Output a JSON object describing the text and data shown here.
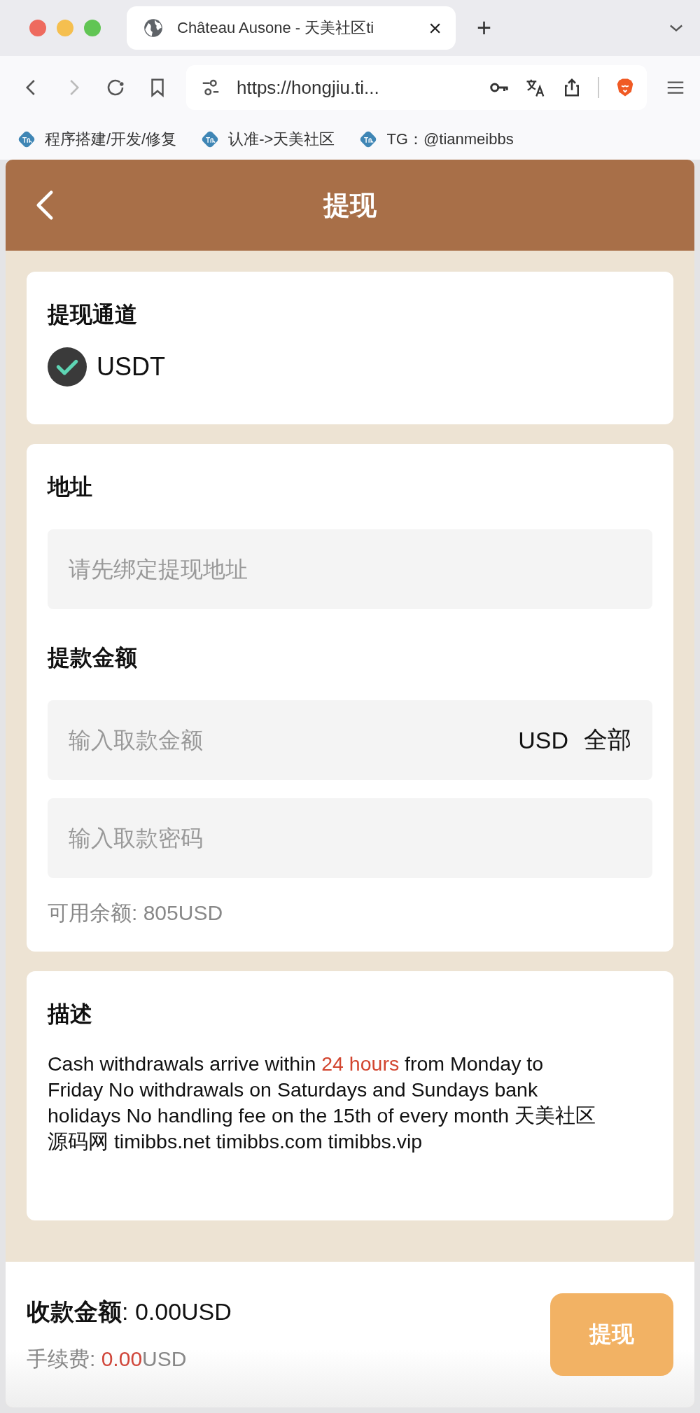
{
  "browser": {
    "tab": {
      "title": "Château Ausone - 天美社区ti",
      "close": "×"
    },
    "new_tab": "+",
    "url": "https://hongjiu.ti...",
    "bookmarks": [
      {
        "label": "程序搭建/开发/修复"
      },
      {
        "label": "认准->天美社区"
      },
      {
        "label": "TG：@tianmeibbs"
      }
    ]
  },
  "header": {
    "title": "提现"
  },
  "channel": {
    "title": "提现通道",
    "options": [
      {
        "label": "USDT",
        "checked": true
      }
    ]
  },
  "form": {
    "address_label": "地址",
    "address": {
      "placeholder": "请先绑定提现地址"
    },
    "amount_label": "提款金额",
    "amount": {
      "placeholder": "输入取款金额",
      "currency": "USD",
      "all": "全部"
    },
    "password": {
      "placeholder": "输入取款密码"
    },
    "balance": "可用余额: 805USD"
  },
  "description": {
    "title": "描述",
    "parts": [
      {
        "kind": "plain",
        "text": "Cash withdrawals arrive within "
      },
      {
        "kind": "highlight",
        "text": "24 hours"
      },
      {
        "kind": "plain",
        "text": " from Monday to Friday No withdrawals on Saturdays and Sundays bank holidays No handling fee on the 15th of every month 天美社区源码网 timibbs.net timibbs.com timibbs.vip"
      }
    ]
  },
  "footer": {
    "received": "**收款金额**: 0.00USD",
    "fee": [
      {
        "kind": "plain",
        "text": "手续费: "
      },
      {
        "kind": "highlight",
        "text": "0.00"
      },
      {
        "kind": "plain",
        "text": "USD"
      }
    ],
    "submit": "提现"
  }
}
